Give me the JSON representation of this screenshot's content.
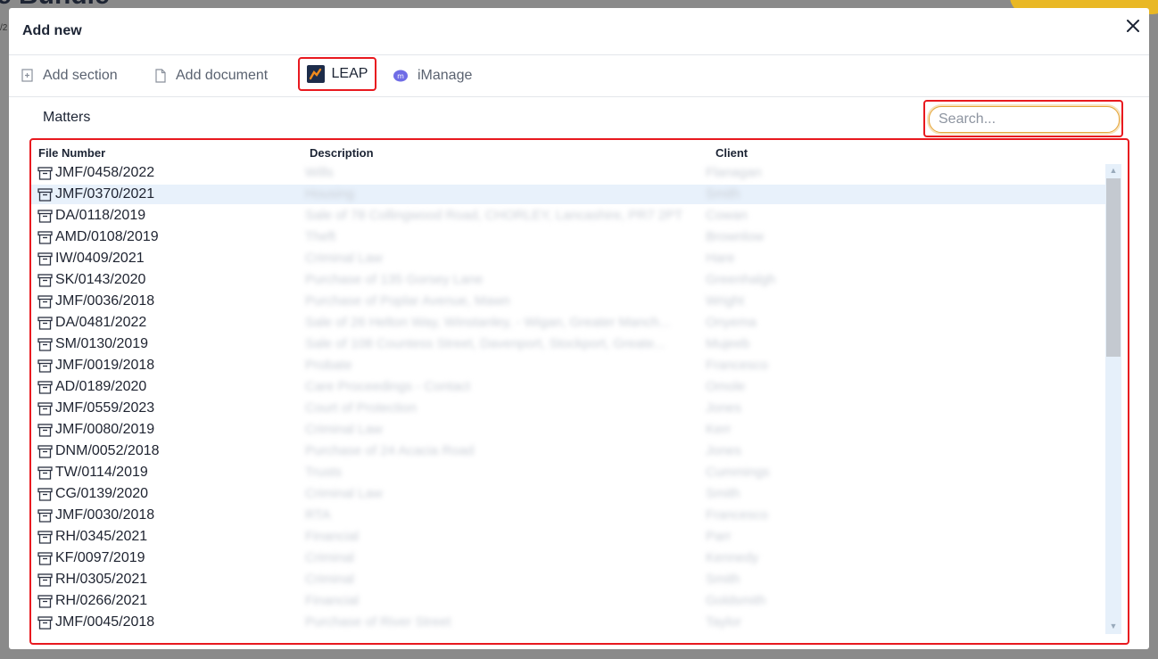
{
  "background": {
    "title": "e Bundle",
    "sub": "/2"
  },
  "dialog": {
    "title": "Add new",
    "tabs": [
      {
        "label": "Add section",
        "icon": "add-section-icon"
      },
      {
        "label": "Add document",
        "icon": "document-icon"
      },
      {
        "label": "LEAP",
        "icon": "leap-logo-icon"
      },
      {
        "label": "iManage",
        "icon": "imanage-logo-icon"
      }
    ],
    "section_label": "Matters",
    "search": {
      "placeholder": "Search...",
      "value": ""
    },
    "columns": {
      "file_number": "File Number",
      "description": "Description",
      "client": "Client"
    },
    "rows": [
      {
        "file": "JMF/0458/2022",
        "desc": "Wills",
        "client": "Flanagan"
      },
      {
        "file": "JMF/0370/2021",
        "desc": "Housing",
        "client": "Smith"
      },
      {
        "file": "DA/0118/2019",
        "desc": "Sale of 78 Collingwood Road, CHORLEY, Lancashire, PR7 2PT",
        "client": "Cowan"
      },
      {
        "file": "AMD/0108/2019",
        "desc": "Theft",
        "client": "Brownlow"
      },
      {
        "file": "IW/0409/2021",
        "desc": "Criminal Law",
        "client": "Hare"
      },
      {
        "file": "SK/0143/2020",
        "desc": "Purchase of 135 Gorsey Lane",
        "client": "Greenhalgh"
      },
      {
        "file": "JMF/0036/2018",
        "desc": "Purchase of Poplar Avenue, Mawn",
        "client": "Wright"
      },
      {
        "file": "DA/0481/2022",
        "desc": "Sale of 26 Helton Way, Winstanley, - Wigan, Greater Manch...",
        "client": "Onyema"
      },
      {
        "file": "SM/0130/2019",
        "desc": "Sale of 108 Countess Street, Davenport, Stockport, Greate...",
        "client": "Mujeeb"
      },
      {
        "file": "JMF/0019/2018",
        "desc": "Probate",
        "client": "Francesco"
      },
      {
        "file": "AD/0189/2020",
        "desc": "Care Proceedings - Contact",
        "client": "Omole"
      },
      {
        "file": "JMF/0559/2023",
        "desc": "Court of Protection",
        "client": "Jones"
      },
      {
        "file": "JMF/0080/2019",
        "desc": "Criminal Law",
        "client": "Kerr"
      },
      {
        "file": "DNM/0052/2018",
        "desc": "Purchase of 24 Acacia Road",
        "client": "Jones"
      },
      {
        "file": "TW/0114/2019",
        "desc": "Trusts",
        "client": "Cummings"
      },
      {
        "file": "CG/0139/2020",
        "desc": "Criminal Law",
        "client": "Smith"
      },
      {
        "file": "JMF/0030/2018",
        "desc": "RTA",
        "client": "Francesco"
      },
      {
        "file": "RH/0345/2021",
        "desc": "Financial",
        "client": "Parr"
      },
      {
        "file": "KF/0097/2019",
        "desc": "Criminal",
        "client": "Kennedy"
      },
      {
        "file": "RH/0305/2021",
        "desc": "Criminal",
        "client": "Smith"
      },
      {
        "file": "RH/0266/2021",
        "desc": "Financial",
        "client": "Goldsmith"
      },
      {
        "file": "JMF/0045/2018",
        "desc": "Purchase of River Street",
        "client": "Taylor"
      }
    ],
    "selected_row_index": 1
  },
  "colors": {
    "highlight": "#e8191f",
    "selected_row": "#e8f1fb",
    "accent": "#e6a63a"
  }
}
